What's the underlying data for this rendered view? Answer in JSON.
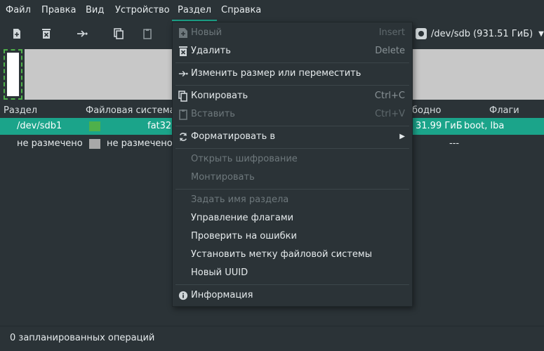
{
  "menubar": {
    "items": [
      "Файл",
      "Правка",
      "Вид",
      "Устройство",
      "Раздел",
      "Справка"
    ]
  },
  "toolbar": {
    "device": "/dev/sdb (931.51 ГиБ)"
  },
  "table": {
    "headers": {
      "partition": "Раздел",
      "filesystem": "Файловая система",
      "free": "бодно",
      "flags": "Флаги"
    },
    "rows": [
      {
        "partition": "/dev/sdb1",
        "filesystem": "fat32",
        "free": "31.99 ГиБ",
        "flags": "boot, lba",
        "color": "#4fb04a"
      },
      {
        "partition": "не размечено",
        "filesystem": "не размечено",
        "free": "---",
        "flags": "",
        "color": "#a8a8a8"
      }
    ]
  },
  "status": {
    "text": "0 запланированных операций"
  },
  "dropdown": {
    "new": {
      "label": "Новый",
      "shortcut": "Insert"
    },
    "delete": {
      "label": "Удалить",
      "shortcut": "Delete"
    },
    "resize": {
      "label": "Изменить размер или переместить"
    },
    "copy": {
      "label": "Копировать",
      "shortcut": "Ctrl+C"
    },
    "paste": {
      "label": "Вставить",
      "shortcut": "Ctrl+V"
    },
    "format": {
      "label": "Форматировать в"
    },
    "open_encryption": {
      "label": "Открыть шифрование"
    },
    "mount": {
      "label": "Монтировать"
    },
    "name_partition": {
      "label": "Задать имя раздела"
    },
    "manage_flags": {
      "label": "Управление флагами"
    },
    "check": {
      "label": "Проверить на ошибки"
    },
    "set_label": {
      "label": "Установить метку файловой системы"
    },
    "new_uuid": {
      "label": "Новый UUID"
    },
    "info": {
      "label": "Информация"
    }
  },
  "colors": {
    "accent": "#1ba48a",
    "background": "#2b3337",
    "fat32": "#4fb04a",
    "unallocated": "#a8a8a8"
  }
}
